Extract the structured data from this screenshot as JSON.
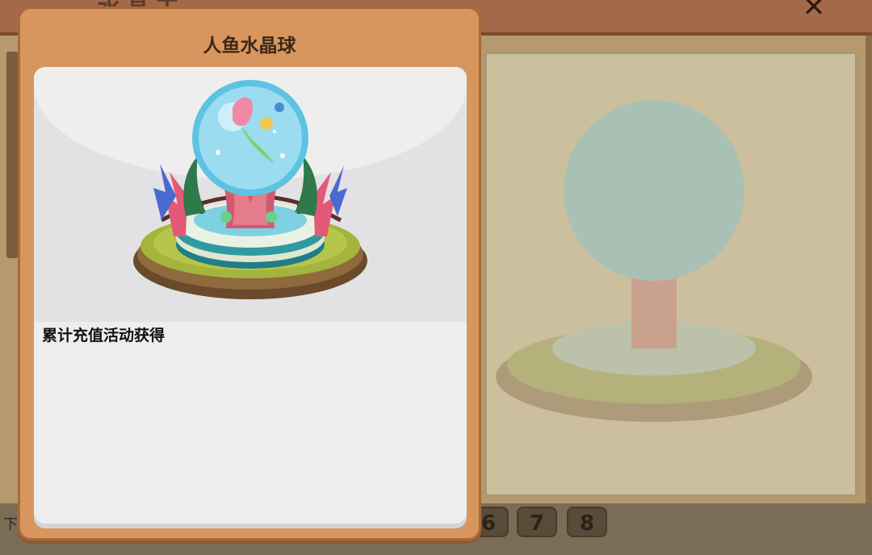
{
  "background": {
    "title": "水晶工",
    "close_icon": "close-icon",
    "bottom_prefix": "下",
    "pages": [
      "6",
      "7",
      "8"
    ]
  },
  "modal": {
    "title": "人鱼水晶球",
    "item_art": "mermaid-crystal-ball-fountain",
    "description": "累计充值活动获得"
  }
}
